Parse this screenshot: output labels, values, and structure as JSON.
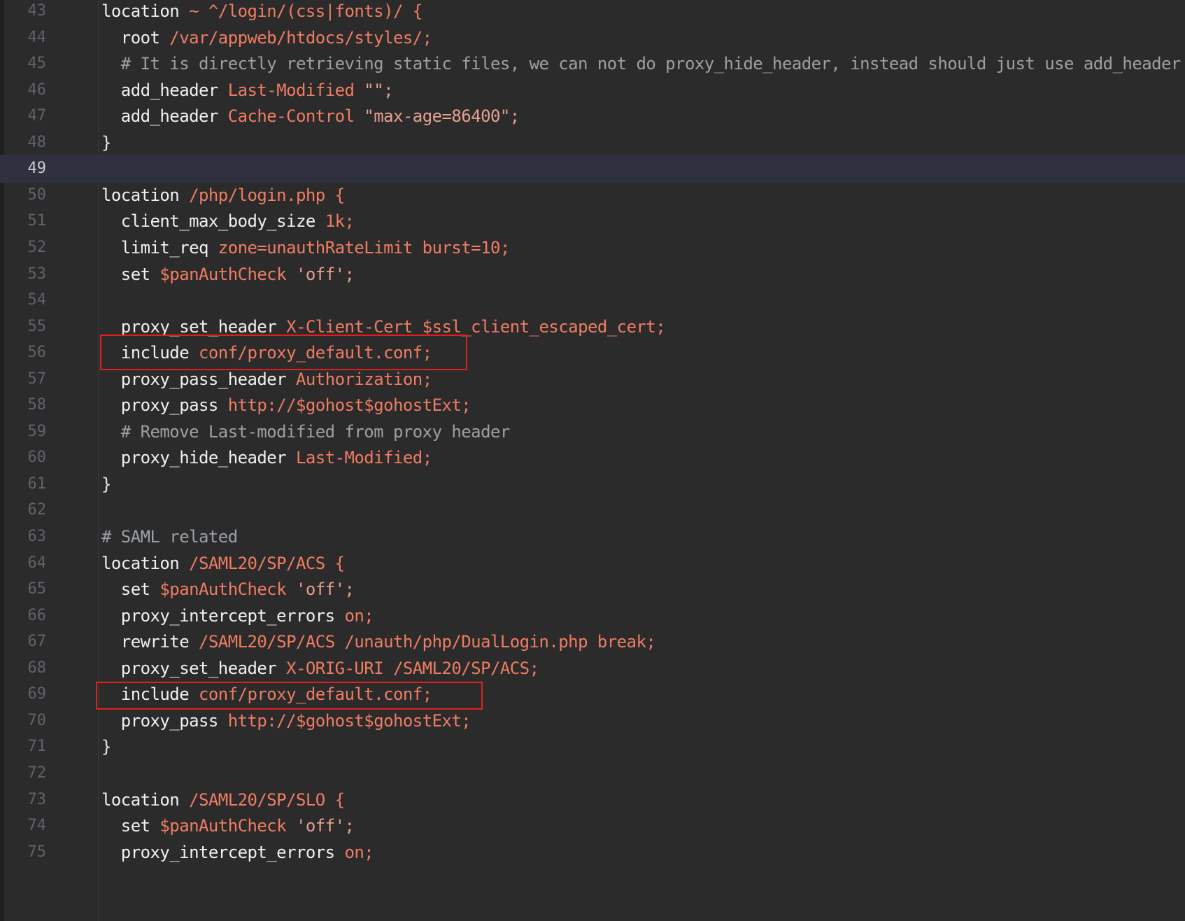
{
  "editor": {
    "current_line": 49,
    "highlighted_lines": [
      56,
      69
    ],
    "lines": [
      {
        "n": "43",
        "tokens": [
          {
            "t": "location ",
            "c": "kw"
          },
          {
            "t": "~ ^/login/(css|fonts)/ {",
            "c": "val"
          }
        ]
      },
      {
        "n": "44",
        "tokens": [
          {
            "t": "  root ",
            "c": "kw"
          },
          {
            "t": "/var/appweb/htdocs/styles/;",
            "c": "val"
          }
        ]
      },
      {
        "n": "45",
        "tokens": [
          {
            "t": "  # It is directly retrieving static files, we can not do proxy_hide_header, instead should just use add_header",
            "c": "cmt"
          }
        ]
      },
      {
        "n": "46",
        "tokens": [
          {
            "t": "  add_header ",
            "c": "kw"
          },
          {
            "t": "Last-Modified ",
            "c": "val"
          },
          {
            "t": "\"\";",
            "c": "str"
          }
        ]
      },
      {
        "n": "47",
        "tokens": [
          {
            "t": "  add_header ",
            "c": "kw"
          },
          {
            "t": "Cache-Control ",
            "c": "val"
          },
          {
            "t": "\"max-age=86400\";",
            "c": "str"
          }
        ]
      },
      {
        "n": "48",
        "tokens": [
          {
            "t": "}",
            "c": "pl"
          }
        ]
      },
      {
        "n": "49",
        "tokens": []
      },
      {
        "n": "50",
        "tokens": [
          {
            "t": "location ",
            "c": "kw"
          },
          {
            "t": "/php/login.php {",
            "c": "val"
          }
        ]
      },
      {
        "n": "51",
        "tokens": [
          {
            "t": "  client_max_body_size ",
            "c": "kw"
          },
          {
            "t": "1k;",
            "c": "val"
          }
        ]
      },
      {
        "n": "52",
        "tokens": [
          {
            "t": "  limit_req ",
            "c": "kw"
          },
          {
            "t": "zone=unauthRateLimit burst=10;",
            "c": "val"
          }
        ]
      },
      {
        "n": "53",
        "tokens": [
          {
            "t": "  set ",
            "c": "kw"
          },
          {
            "t": "$panAuthCheck ",
            "c": "val"
          },
          {
            "t": "'off';",
            "c": "str"
          }
        ]
      },
      {
        "n": "54",
        "tokens": []
      },
      {
        "n": "55",
        "tokens": [
          {
            "t": "  proxy_set_header ",
            "c": "kw"
          },
          {
            "t": "X-Client-Cert $ssl_client_escaped_cert;",
            "c": "val"
          }
        ]
      },
      {
        "n": "56",
        "tokens": [
          {
            "t": "  include ",
            "c": "kw"
          },
          {
            "t": "conf/proxy_default.conf;",
            "c": "val"
          }
        ]
      },
      {
        "n": "57",
        "tokens": [
          {
            "t": "  proxy_pass_header ",
            "c": "kw"
          },
          {
            "t": "Authorization;",
            "c": "val"
          }
        ]
      },
      {
        "n": "58",
        "tokens": [
          {
            "t": "  proxy_pass ",
            "c": "kw"
          },
          {
            "t": "http://$gohost$gohostExt;",
            "c": "val"
          }
        ]
      },
      {
        "n": "59",
        "tokens": [
          {
            "t": "  # Remove Last-modified from proxy header",
            "c": "cmt"
          }
        ]
      },
      {
        "n": "60",
        "tokens": [
          {
            "t": "  proxy_hide_header ",
            "c": "kw"
          },
          {
            "t": "Last-Modified;",
            "c": "val"
          }
        ]
      },
      {
        "n": "61",
        "tokens": [
          {
            "t": "}",
            "c": "pl"
          }
        ]
      },
      {
        "n": "62",
        "tokens": []
      },
      {
        "n": "63",
        "tokens": [
          {
            "t": "# SAML related",
            "c": "cmt"
          }
        ]
      },
      {
        "n": "64",
        "tokens": [
          {
            "t": "location ",
            "c": "kw"
          },
          {
            "t": "/SAML20/SP/ACS {",
            "c": "val"
          }
        ]
      },
      {
        "n": "65",
        "tokens": [
          {
            "t": "  set ",
            "c": "kw"
          },
          {
            "t": "$panAuthCheck ",
            "c": "val"
          },
          {
            "t": "'off';",
            "c": "str"
          }
        ]
      },
      {
        "n": "66",
        "tokens": [
          {
            "t": "  proxy_intercept_errors ",
            "c": "kw"
          },
          {
            "t": "on;",
            "c": "val"
          }
        ]
      },
      {
        "n": "67",
        "tokens": [
          {
            "t": "  rewrite ",
            "c": "kw"
          },
          {
            "t": "/SAML20/SP/ACS /unauth/php/DualLogin.php break;",
            "c": "val"
          }
        ]
      },
      {
        "n": "68",
        "tokens": [
          {
            "t": "  proxy_set_header ",
            "c": "kw"
          },
          {
            "t": "X-ORIG-URI /SAML20/SP/ACS;",
            "c": "val"
          }
        ]
      },
      {
        "n": "69",
        "tokens": [
          {
            "t": "  include ",
            "c": "kw"
          },
          {
            "t": "conf/proxy_default.conf;",
            "c": "val"
          }
        ]
      },
      {
        "n": "70",
        "tokens": [
          {
            "t": "  proxy_pass ",
            "c": "kw"
          },
          {
            "t": "http://$gohost$gohostExt;",
            "c": "val"
          }
        ]
      },
      {
        "n": "71",
        "tokens": [
          {
            "t": "}",
            "c": "pl"
          }
        ]
      },
      {
        "n": "72",
        "tokens": []
      },
      {
        "n": "73",
        "tokens": [
          {
            "t": "location ",
            "c": "kw"
          },
          {
            "t": "/SAML20/SP/SLO {",
            "c": "val"
          }
        ]
      },
      {
        "n": "74",
        "tokens": [
          {
            "t": "  set ",
            "c": "kw"
          },
          {
            "t": "$panAuthCheck ",
            "c": "val"
          },
          {
            "t": "'off';",
            "c": "str"
          }
        ]
      },
      {
        "n": "75",
        "tokens": [
          {
            "t": "  proxy_intercept_errors ",
            "c": "kw"
          },
          {
            "t": "on;",
            "c": "val"
          }
        ]
      }
    ]
  },
  "colors": {
    "background": "#2b2b2b",
    "current_line_bg": "#2f323e",
    "keyword": "#f0f0f0",
    "value": "#f07c63",
    "comment": "#9aa0a6",
    "line_number": "#5f636b",
    "highlight_box": "#e02020"
  }
}
